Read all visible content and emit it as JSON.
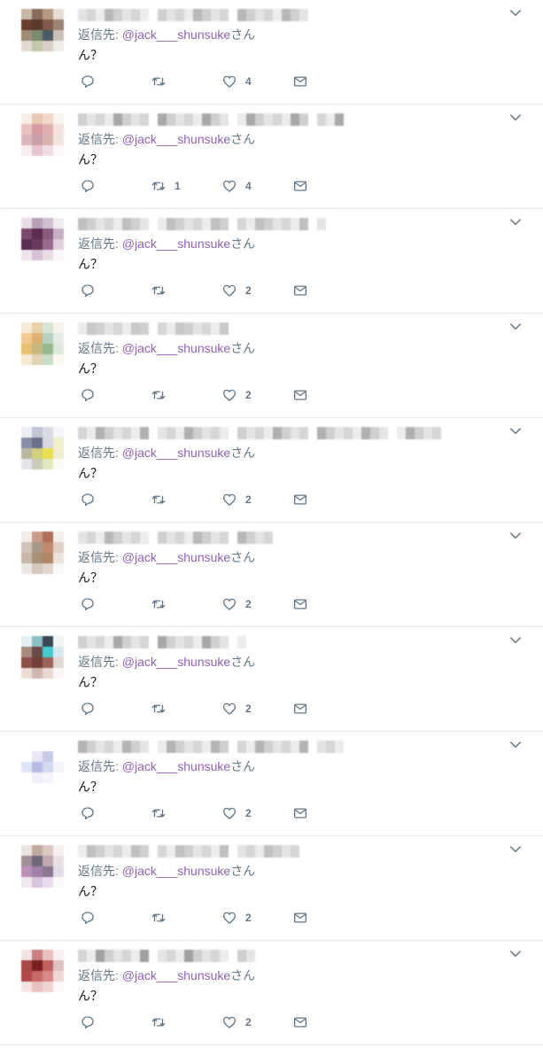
{
  "reply_prefix": "返信先:",
  "reply_suffix": "さん",
  "colors": {
    "handle": "#8e62b8",
    "icon": "#657786",
    "divider": "#e6ecf0"
  },
  "icons": [
    "chevron-down-icon",
    "reply-icon",
    "retweet-icon",
    "like-icon",
    "direct-message-icon"
  ],
  "tweets": [
    {
      "handle": "@jack___shunsuke",
      "text": "ん？",
      "reply_count": "",
      "retweet_count": "",
      "like_count": "4",
      "avatar": [
        "#c9b8a8",
        "#8a6a58",
        "#b49a86",
        "#e6ddd4",
        "#6b3f2f",
        "#5a3b2e",
        "#7d5b4d",
        "#9c8474",
        "#a08a78",
        "#7a8a6c",
        "#4a5a66",
        "#cbbfb6",
        "#e3dbd3",
        "#c0c8a8",
        "#d8d0c8",
        "#f0ece8"
      ]
    },
    {
      "handle": "@jack___shunsuke",
      "text": "ん？",
      "reply_count": "",
      "retweet_count": "1",
      "like_count": "4",
      "avatar": [
        "#f6ede4",
        "#e8c9b4",
        "#f1d8c8",
        "#faf4ee",
        "#e9c3c0",
        "#d79aa0",
        "#e0b0b0",
        "#f3e1dc",
        "#dcb6bf",
        "#c9a0a8",
        "#d8b4b0",
        "#efe4e0",
        "#f5ecee",
        "#e8c4d0",
        "#f0dde4",
        "#fbf6f7"
      ]
    },
    {
      "handle": "@jack___shunsuke",
      "text": "ん？",
      "reply_count": "",
      "retweet_count": "",
      "like_count": "2",
      "avatar": [
        "#e8dde6",
        "#b8a0b8",
        "#d0c0d0",
        "#f2ecf2",
        "#7a4a6a",
        "#5e2c4e",
        "#8a5a7a",
        "#c8b0c4",
        "#5a3050",
        "#6a3a5c",
        "#9a6a8c",
        "#e0d0dc",
        "#f0e4ec",
        "#d8c0d4",
        "#e8dce8",
        "#faf6fa"
      ]
    },
    {
      "handle": "@jack___shunsuke",
      "text": "ん？",
      "reply_count": "",
      "retweet_count": "",
      "like_count": "2",
      "avatar": [
        "#f5ecd8",
        "#e8d0a8",
        "#d8e4d8",
        "#f7f2ea",
        "#f0c890",
        "#e0b070",
        "#b8d0c0",
        "#e4ece4",
        "#e8c070",
        "#c8b880",
        "#98b890",
        "#dfe8dc",
        "#f6ead4",
        "#e0d4b0",
        "#c8dcc8",
        "#fbf8f2"
      ]
    },
    {
      "handle": "@jack___shunsuke",
      "text": "ん？",
      "reply_count": "",
      "retweet_count": "",
      "like_count": "2",
      "avatar": [
        "#eceef4",
        "#c0c4d4",
        "#d8dae4",
        "#f4f4f8",
        "#8890a8",
        "#6a708c",
        "#d8d8e0",
        "#f0f0c8",
        "#b8b8a0",
        "#d0d080",
        "#e8e050",
        "#f0ecd0",
        "#e4e4e8",
        "#c8ccb8",
        "#e4e8c0",
        "#fafaf4"
      ]
    },
    {
      "handle": "@jack___shunsuke",
      "text": "ん？",
      "reply_count": "",
      "retweet_count": "",
      "like_count": "2",
      "avatar": [
        "#f2ece8",
        "#c89c88",
        "#b07058",
        "#f4eeea",
        "#d0c4b8",
        "#a8988c",
        "#c08a70",
        "#e0d0c4",
        "#c8b8a8",
        "#a89078",
        "#b08868",
        "#ece4dc",
        "#ece8e4",
        "#d4c8bc",
        "#e0d8d0",
        "#faf8f6"
      ]
    },
    {
      "handle": "@jack___shunsuke",
      "text": "ん？",
      "reply_count": "",
      "retweet_count": "",
      "like_count": "2",
      "avatar": [
        "#e4f0f0",
        "#88c0c4",
        "#3c4858",
        "#f0f4f4",
        "#a88c80",
        "#6a4a44",
        "#48c8d0",
        "#d8e8ec",
        "#8a5048",
        "#704038",
        "#9a6458",
        "#e4d8d4",
        "#ecdcd8",
        "#d0b8b0",
        "#e8d8d4",
        "#faf6f6"
      ]
    },
    {
      "handle": "@jack___shunsuke",
      "text": "ん？",
      "reply_count": "",
      "retweet_count": "",
      "like_count": "2",
      "avatar": [
        "#ffffff",
        "#ffffff",
        "#ffffff",
        "#ffffff",
        "#ffffff",
        "#e8e8f4",
        "#c8c8e8",
        "#ffffff",
        "#e0e4f4",
        "#b8bce4",
        "#d4d8f0",
        "#f4f4fa",
        "#ffffff",
        "#f0f0f8",
        "#f4f4fa",
        "#ffffff"
      ]
    },
    {
      "handle": "@jack___shunsuke",
      "text": "ん？",
      "reply_count": "",
      "retweet_count": "",
      "like_count": "2",
      "avatar": [
        "#ece4e0",
        "#c0a8a0",
        "#d8c8c0",
        "#f4f0ee",
        "#a09098",
        "#706878",
        "#c0a8b0",
        "#e8e0e4",
        "#b890b8",
        "#a080a8",
        "#8a7890",
        "#e4dce8",
        "#f0e8f0",
        "#d8c4dc",
        "#e8dcec",
        "#faf8fa"
      ]
    },
    {
      "handle": "@jack___shunsuke",
      "text": "ん？",
      "reply_count": "",
      "retweet_count": "",
      "like_count": "2",
      "avatar": [
        "#f0e4e4",
        "#c88080",
        "#e8c0c0",
        "#f8f0f0",
        "#a84848",
        "#7a2020",
        "#c06060",
        "#e0c0c0",
        "#b04848",
        "#c86868",
        "#d88888",
        "#f0d8d8",
        "#f4e4e4",
        "#e8c0c0",
        "#f0d4d4",
        "#fcf8f8"
      ]
    }
  ]
}
